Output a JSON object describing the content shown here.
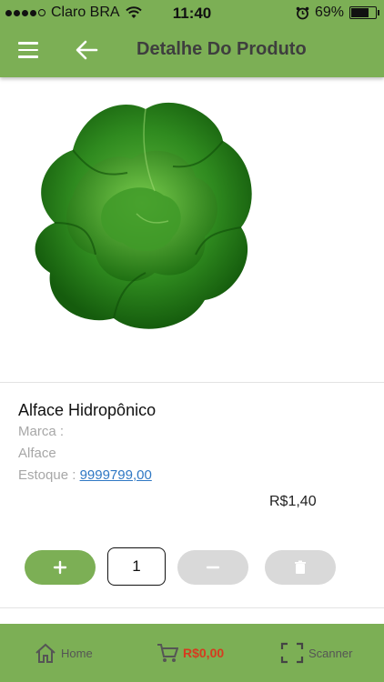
{
  "status": {
    "carrier": "Claro BRA",
    "time": "11:40",
    "battery": "69%",
    "battery_level": 0.69
  },
  "header": {
    "title": "Detalhe Do Produto"
  },
  "product": {
    "name": "Alface Hidropônico",
    "brand_label": "Marca :",
    "brand_value": "Alface",
    "stock_label": "Estoque :",
    "stock_value": "9999799,00",
    "price": "R$1,40",
    "quantity": "1"
  },
  "colors": {
    "accent": "#7caf55",
    "cart_total": "#d63b1f",
    "link": "#2f78c4"
  },
  "nav": {
    "home": "Home",
    "cart_total": "R$0,00",
    "scanner": "Scanner"
  },
  "icons": {
    "menu": "hamburger-icon",
    "back": "arrow-left-icon",
    "add": "plus-icon",
    "remove": "minus-icon",
    "delete": "trash-icon",
    "home": "home-icon",
    "cart": "cart-icon",
    "scanner": "scan-icon"
  }
}
